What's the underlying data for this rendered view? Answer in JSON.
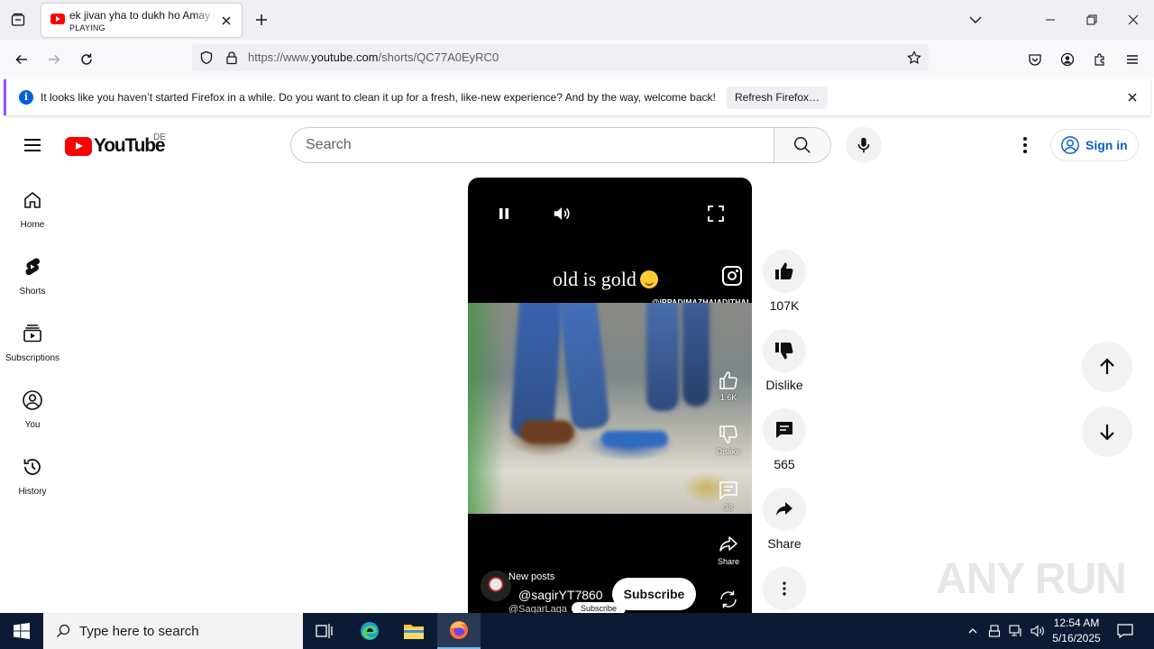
{
  "browser": {
    "tab": {
      "title": "ek jivan yha to dukh ho Amay ha",
      "status": "PLAYING"
    },
    "url": {
      "prefix": "https://www.",
      "domain": "youtube.com",
      "path": "/shorts/QC77A0EyRC0"
    },
    "notification": {
      "text": "It looks like you haven’t started Firefox in a while. Do you want to clean it up for a fresh, like-new experience? And by the way, welcome back!",
      "button": "Refresh Firefox…"
    }
  },
  "youtube": {
    "logo_text": "YouTube",
    "country_code": "DE",
    "search_placeholder": "Search",
    "sign_in": "Sign in",
    "sidebar": [
      {
        "label": "Home",
        "icon": "home-icon"
      },
      {
        "label": "Shorts",
        "icon": "shorts-icon"
      },
      {
        "label": "Subscriptions",
        "icon": "subscriptions-icon"
      },
      {
        "label": "You",
        "icon": "you-icon"
      },
      {
        "label": "History",
        "icon": "history-icon"
      }
    ],
    "short": {
      "caption": "old is gold",
      "watermark": "@IPPADIMAZHAIADITHAL",
      "inner_likes": "1.6K",
      "inner_dislike": "Dislike",
      "inner_comments": "38",
      "inner_share": "Share",
      "channel_label": "New posts",
      "channel_name": "@sagirYT7860",
      "subscribe": "Subscribe",
      "under_channel": "@SagarLaga",
      "under_subscribe": "Subscribe"
    },
    "actions": {
      "likes": "107K",
      "dislike": "Dislike",
      "comments": "565",
      "share": "Share"
    }
  },
  "watermark": {
    "text": "ANY RUN"
  },
  "taskbar": {
    "search_placeholder": "Type here to search",
    "time": "12:54 AM",
    "date": "5/16/2025"
  },
  "colors": {
    "youtube_red": "#ff0000",
    "link_blue": "#065fd4",
    "firefox_accent": "#9059ff",
    "taskbar_bg": "#0b1b33"
  }
}
